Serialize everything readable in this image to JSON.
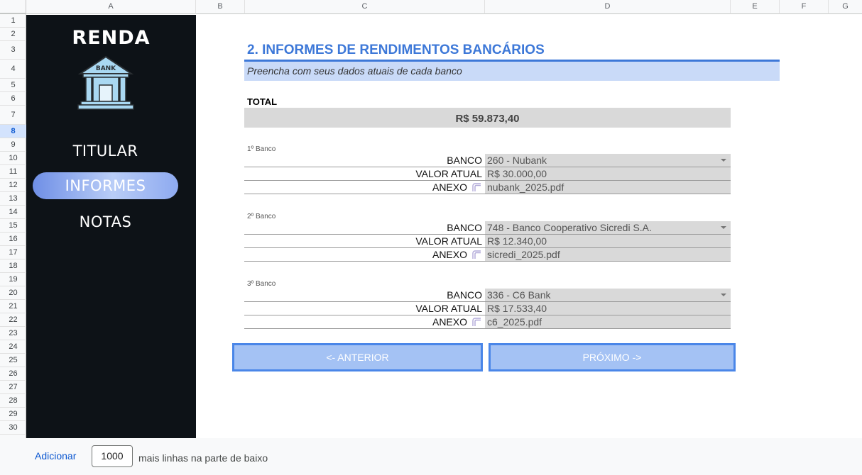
{
  "columns": [
    "A",
    "B",
    "C",
    "D",
    "E",
    "F",
    "G"
  ],
  "rows": [
    "1",
    "2",
    "3",
    "4",
    "5",
    "6",
    "7",
    "8",
    "9",
    "10",
    "11",
    "12",
    "13",
    "14",
    "15",
    "16",
    "17",
    "18",
    "19",
    "20",
    "21",
    "22",
    "23",
    "24",
    "25",
    "26",
    "27",
    "28",
    "29",
    "30"
  ],
  "selected_row": "8",
  "sidebar": {
    "brand": "RENDA",
    "bank_sign": "BANK",
    "items": [
      {
        "label": "TITULAR"
      },
      {
        "label": "INFORMES"
      },
      {
        "label": "NOTAS"
      }
    ]
  },
  "main": {
    "title": "2. INFORMES DE RENDIMENTOS BANCÁRIOS",
    "subtitle": "Preencha com seus dados atuais de cada banco",
    "total_label": "TOTAL",
    "total_value": "R$ 59.873,40",
    "banks": [
      {
        "header": "1º Banco",
        "banco_label": "BANCO",
        "banco": "260 - Nubank",
        "valor_label": "VALOR ATUAL",
        "valor": "R$ 30.000,00",
        "anexo_label": "ANEXO",
        "anexo": "nubank_2025.pdf"
      },
      {
        "header": "2º Banco",
        "banco_label": "BANCO",
        "banco": "748 - Banco Cooperativo Sicredi S.A.",
        "valor_label": "VALOR ATUAL",
        "valor": "R$ 12.340,00",
        "anexo_label": "ANEXO",
        "anexo": "sicredi_2025.pdf"
      },
      {
        "header": "3º Banco",
        "banco_label": "BANCO",
        "banco": "336 - C6 Bank",
        "valor_label": "VALOR ATUAL",
        "valor": "R$ 17.533,40",
        "anexo_label": "ANEXO",
        "anexo": "c6_2025.pdf"
      }
    ],
    "prev_label": "<- ANTERIOR",
    "next_label": "PRÓXIMO ->"
  },
  "bottom": {
    "add_label": "Adicionar",
    "add_value": "1000",
    "add_text": "mais linhas na parte de baixo"
  },
  "colors": {
    "accent": "#3d78d8",
    "subtitle_bg": "#c9daf8",
    "sidebar_bg": "#0d1217",
    "button_bg": "#a4c2f4",
    "button_border": "#4a86e8",
    "field_bg": "#d9d9d9"
  }
}
